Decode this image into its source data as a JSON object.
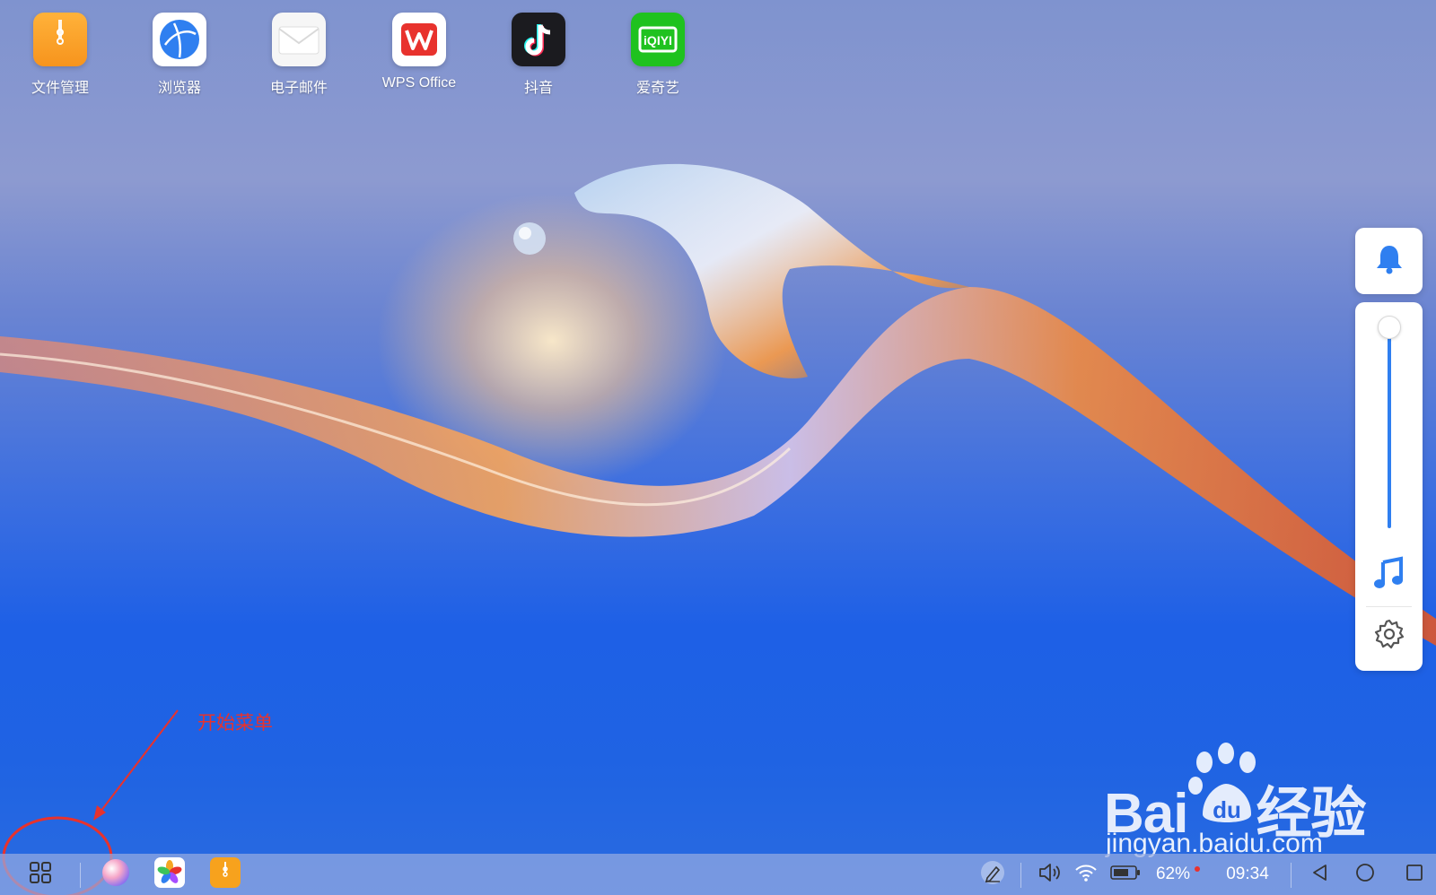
{
  "desktop": {
    "icons": [
      {
        "label": "文件管理",
        "icon": "file-manager-icon"
      },
      {
        "label": "浏览器",
        "icon": "browser-icon"
      },
      {
        "label": "电子邮件",
        "icon": "email-icon"
      },
      {
        "label": "WPS Office",
        "icon": "wps-office-icon"
      },
      {
        "label": "抖音",
        "icon": "douyin-icon"
      },
      {
        "label": "爱奇艺",
        "icon": "iqiyi-icon"
      }
    ],
    "iqiyi_logo_text": "iQIYI"
  },
  "side_panel": {
    "bell_icon": "bell-icon",
    "volume_level": 1.0,
    "music_icon": "music-note-icon",
    "settings_icon": "gear-icon"
  },
  "annotation": {
    "text": "开始菜单",
    "color": "#e8322d"
  },
  "watermark": {
    "brand": "Bai",
    "brand_suffix": "经验",
    "url": "jingyan.baidu.com",
    "paw_text": "du"
  },
  "taskbar": {
    "start_menu_icon": "grid-icon",
    "pinned_apps": [
      "assistant-ball-icon",
      "gallery-icon",
      "file-manager-icon"
    ],
    "stylus_icon": "stylus-icon",
    "volume_icon": "speaker-icon",
    "wifi_icon": "wifi-icon",
    "battery_icon": "battery-icon",
    "battery_percent": "62%",
    "time": "09:34",
    "nav": [
      "back-icon",
      "home-icon",
      "recents-icon"
    ]
  },
  "colors": {
    "accent_blue": "#2f7ff0",
    "annotation_red": "#e8322d"
  }
}
